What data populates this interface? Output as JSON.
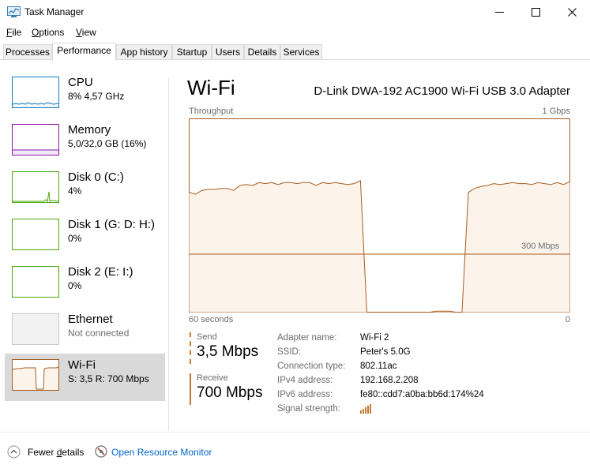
{
  "window": {
    "title": "Task Manager",
    "minimize_icon": "minimize-icon",
    "maximize_icon": "maximize-icon",
    "close_icon": "close-icon"
  },
  "menu": {
    "file": {
      "accel": "F",
      "rest": "ile"
    },
    "options": {
      "accel": "O",
      "rest": "ptions"
    },
    "view": {
      "accel": "V",
      "rest": "iew"
    }
  },
  "tabs": [
    {
      "label": "Processes"
    },
    {
      "label": "Performance",
      "active": true
    },
    {
      "label": "App history"
    },
    {
      "label": "Startup"
    },
    {
      "label": "Users"
    },
    {
      "label": "Details"
    },
    {
      "label": "Services"
    }
  ],
  "sidebar": {
    "items": [
      {
        "title": "CPU",
        "subtitle": "8% 4,57 GHz",
        "color": "#117dbb"
      },
      {
        "title": "Memory",
        "subtitle": "5,0/32,0 GB (16%)",
        "color": "#8b12ae"
      },
      {
        "title": "Disk 0 (C:)",
        "subtitle": "4%",
        "color": "#4da60c"
      },
      {
        "title": "Disk 1 (G: D: H:)",
        "subtitle": "0%",
        "color": "#4da60c"
      },
      {
        "title": "Disk 2 (E: I:)",
        "subtitle": "0%",
        "color": "#4da60c"
      },
      {
        "title": "Ethernet",
        "subtitle": "Not connected",
        "color": "#a0a0a0"
      },
      {
        "title": "Wi-Fi",
        "subtitle": "S: 3,5  R: 700 Mbps",
        "color": "#a75d20",
        "selected": true
      }
    ]
  },
  "main": {
    "title": "Wi-Fi",
    "adapter": "D-Link DWA-192 AC1900 Wi-Fi USB 3.0 Adapter",
    "throughput_label": "Throughput",
    "max_label": "1 Gbps",
    "mark_label": "300 Mbps",
    "seconds_label": "60 seconds",
    "zero_label": "0",
    "send_label": "Send",
    "send_value": "3,5 Mbps",
    "receive_label": "Receive",
    "receive_value": "700 Mbps",
    "details": [
      {
        "key": "Adapter name:",
        "value": "Wi-Fi 2"
      },
      {
        "key": "SSID:",
        "value": "Peter's 5.0G"
      },
      {
        "key": "Connection type:",
        "value": "802.11ac"
      },
      {
        "key": "IPv4 address:",
        "value": "192.168.2.208"
      },
      {
        "key": "IPv6 address:",
        "value": "fe80::cdd7:a0ba:bb6d:174%24"
      },
      {
        "key": "Signal strength:",
        "value": ""
      }
    ],
    "signal_icon": "signal-strength-icon",
    "graph_color": "#a75d20",
    "graph_fill": "#fcf3eb"
  },
  "footer": {
    "fewer_details_accel": "d",
    "fewer_details_pre": "Fewer ",
    "fewer_details_post": "etails",
    "resource_monitor": "Open Resource Monitor"
  },
  "chart_data": {
    "type": "area",
    "title": "Throughput",
    "xlabel": "60 seconds",
    "ylabel": "",
    "x": [
      60,
      59,
      58,
      57,
      56,
      55,
      54,
      53,
      52,
      51,
      50,
      49,
      48,
      47,
      46,
      45,
      44,
      43,
      42,
      41,
      40,
      39,
      38,
      37,
      36,
      35,
      34,
      33,
      32,
      31,
      30,
      29,
      28,
      27,
      26,
      25,
      24,
      23,
      22,
      21,
      20,
      19,
      18,
      17,
      16,
      15,
      14,
      13,
      12,
      11,
      10,
      9,
      8,
      7,
      6,
      5,
      4,
      3,
      2,
      1,
      0
    ],
    "series": [
      {
        "values": [
          620,
          610,
          630,
          635,
          635,
          640,
          640,
          630,
          655,
          660,
          655,
          670,
          665,
          670,
          660,
          670,
          670,
          665,
          670,
          670,
          655,
          670,
          665,
          670,
          665,
          660,
          665,
          680,
          0,
          0,
          0,
          0,
          0,
          0,
          0,
          0,
          0,
          0,
          0,
          5,
          5,
          5,
          0,
          0,
          620,
          640,
          650,
          655,
          665,
          660,
          665,
          670,
          665,
          665,
          660,
          670,
          665,
          660,
          670,
          660,
          675
        ]
      }
    ],
    "ylim": [
      0,
      1000
    ],
    "xlim": [
      60,
      0
    ],
    "reference_line": 300,
    "grid": true
  }
}
